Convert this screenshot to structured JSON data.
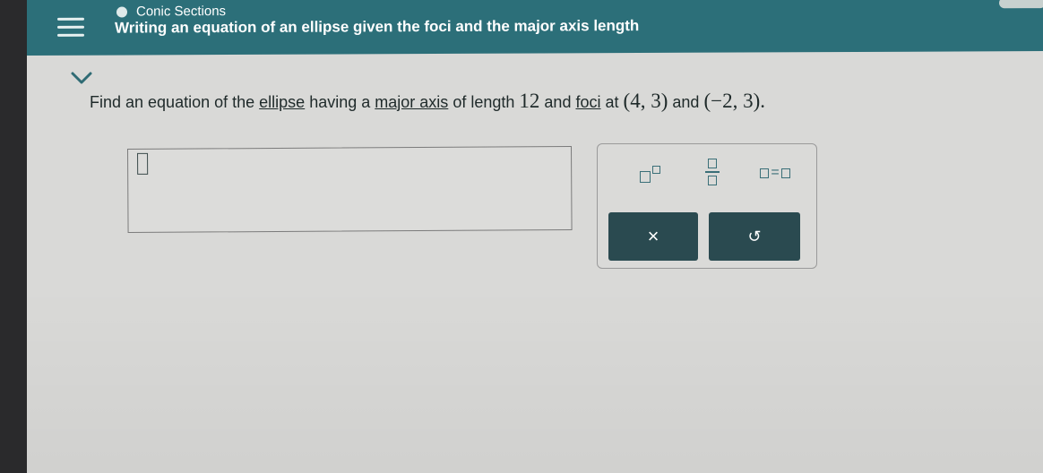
{
  "header": {
    "topic": "Conic Sections",
    "title": "Writing an equation of an ellipse given the foci and the major axis length"
  },
  "question": {
    "part1": "Find an equation of the",
    "link1": "ellipse",
    "part2": "having a",
    "link2": "major axis",
    "part3": "of length",
    "length": "12",
    "part4": "and",
    "link3": "foci",
    "part5": "at",
    "point1": "(4, 3)",
    "part6": "and",
    "point2": "(−2, 3).",
    "end": ""
  },
  "keypad": {
    "equals": "=",
    "clear_icon": "×",
    "undo_icon": "↺"
  },
  "colors": {
    "header": "#2c6f79",
    "dark_button": "#2a4a50",
    "accent": "#3a6f78"
  }
}
